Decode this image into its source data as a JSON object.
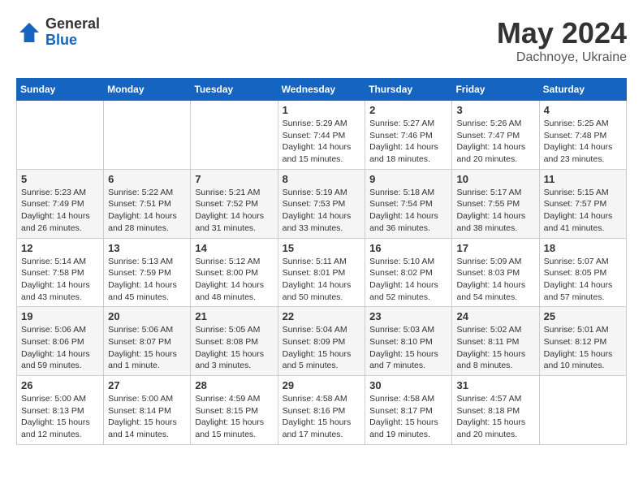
{
  "logo": {
    "general": "General",
    "blue": "Blue"
  },
  "title": {
    "month": "May 2024",
    "location": "Dachnoye, Ukraine"
  },
  "weekdays": [
    "Sunday",
    "Monday",
    "Tuesday",
    "Wednesday",
    "Thursday",
    "Friday",
    "Saturday"
  ],
  "rows": [
    [
      {
        "day": "",
        "sunrise": "",
        "sunset": "",
        "daylight": ""
      },
      {
        "day": "",
        "sunrise": "",
        "sunset": "",
        "daylight": ""
      },
      {
        "day": "",
        "sunrise": "",
        "sunset": "",
        "daylight": ""
      },
      {
        "day": "1",
        "sunrise": "Sunrise: 5:29 AM",
        "sunset": "Sunset: 7:44 PM",
        "daylight": "Daylight: 14 hours and 15 minutes."
      },
      {
        "day": "2",
        "sunrise": "Sunrise: 5:27 AM",
        "sunset": "Sunset: 7:46 PM",
        "daylight": "Daylight: 14 hours and 18 minutes."
      },
      {
        "day": "3",
        "sunrise": "Sunrise: 5:26 AM",
        "sunset": "Sunset: 7:47 PM",
        "daylight": "Daylight: 14 hours and 20 minutes."
      },
      {
        "day": "4",
        "sunrise": "Sunrise: 5:25 AM",
        "sunset": "Sunset: 7:48 PM",
        "daylight": "Daylight: 14 hours and 23 minutes."
      }
    ],
    [
      {
        "day": "5",
        "sunrise": "Sunrise: 5:23 AM",
        "sunset": "Sunset: 7:49 PM",
        "daylight": "Daylight: 14 hours and 26 minutes."
      },
      {
        "day": "6",
        "sunrise": "Sunrise: 5:22 AM",
        "sunset": "Sunset: 7:51 PM",
        "daylight": "Daylight: 14 hours and 28 minutes."
      },
      {
        "day": "7",
        "sunrise": "Sunrise: 5:21 AM",
        "sunset": "Sunset: 7:52 PM",
        "daylight": "Daylight: 14 hours and 31 minutes."
      },
      {
        "day": "8",
        "sunrise": "Sunrise: 5:19 AM",
        "sunset": "Sunset: 7:53 PM",
        "daylight": "Daylight: 14 hours and 33 minutes."
      },
      {
        "day": "9",
        "sunrise": "Sunrise: 5:18 AM",
        "sunset": "Sunset: 7:54 PM",
        "daylight": "Daylight: 14 hours and 36 minutes."
      },
      {
        "day": "10",
        "sunrise": "Sunrise: 5:17 AM",
        "sunset": "Sunset: 7:55 PM",
        "daylight": "Daylight: 14 hours and 38 minutes."
      },
      {
        "day": "11",
        "sunrise": "Sunrise: 5:15 AM",
        "sunset": "Sunset: 7:57 PM",
        "daylight": "Daylight: 14 hours and 41 minutes."
      }
    ],
    [
      {
        "day": "12",
        "sunrise": "Sunrise: 5:14 AM",
        "sunset": "Sunset: 7:58 PM",
        "daylight": "Daylight: 14 hours and 43 minutes."
      },
      {
        "day": "13",
        "sunrise": "Sunrise: 5:13 AM",
        "sunset": "Sunset: 7:59 PM",
        "daylight": "Daylight: 14 hours and 45 minutes."
      },
      {
        "day": "14",
        "sunrise": "Sunrise: 5:12 AM",
        "sunset": "Sunset: 8:00 PM",
        "daylight": "Daylight: 14 hours and 48 minutes."
      },
      {
        "day": "15",
        "sunrise": "Sunrise: 5:11 AM",
        "sunset": "Sunset: 8:01 PM",
        "daylight": "Daylight: 14 hours and 50 minutes."
      },
      {
        "day": "16",
        "sunrise": "Sunrise: 5:10 AM",
        "sunset": "Sunset: 8:02 PM",
        "daylight": "Daylight: 14 hours and 52 minutes."
      },
      {
        "day": "17",
        "sunrise": "Sunrise: 5:09 AM",
        "sunset": "Sunset: 8:03 PM",
        "daylight": "Daylight: 14 hours and 54 minutes."
      },
      {
        "day": "18",
        "sunrise": "Sunrise: 5:07 AM",
        "sunset": "Sunset: 8:05 PM",
        "daylight": "Daylight: 14 hours and 57 minutes."
      }
    ],
    [
      {
        "day": "19",
        "sunrise": "Sunrise: 5:06 AM",
        "sunset": "Sunset: 8:06 PM",
        "daylight": "Daylight: 14 hours and 59 minutes."
      },
      {
        "day": "20",
        "sunrise": "Sunrise: 5:06 AM",
        "sunset": "Sunset: 8:07 PM",
        "daylight": "Daylight: 15 hours and 1 minute."
      },
      {
        "day": "21",
        "sunrise": "Sunrise: 5:05 AM",
        "sunset": "Sunset: 8:08 PM",
        "daylight": "Daylight: 15 hours and 3 minutes."
      },
      {
        "day": "22",
        "sunrise": "Sunrise: 5:04 AM",
        "sunset": "Sunset: 8:09 PM",
        "daylight": "Daylight: 15 hours and 5 minutes."
      },
      {
        "day": "23",
        "sunrise": "Sunrise: 5:03 AM",
        "sunset": "Sunset: 8:10 PM",
        "daylight": "Daylight: 15 hours and 7 minutes."
      },
      {
        "day": "24",
        "sunrise": "Sunrise: 5:02 AM",
        "sunset": "Sunset: 8:11 PM",
        "daylight": "Daylight: 15 hours and 8 minutes."
      },
      {
        "day": "25",
        "sunrise": "Sunrise: 5:01 AM",
        "sunset": "Sunset: 8:12 PM",
        "daylight": "Daylight: 15 hours and 10 minutes."
      }
    ],
    [
      {
        "day": "26",
        "sunrise": "Sunrise: 5:00 AM",
        "sunset": "Sunset: 8:13 PM",
        "daylight": "Daylight: 15 hours and 12 minutes."
      },
      {
        "day": "27",
        "sunrise": "Sunrise: 5:00 AM",
        "sunset": "Sunset: 8:14 PM",
        "daylight": "Daylight: 15 hours and 14 minutes."
      },
      {
        "day": "28",
        "sunrise": "Sunrise: 4:59 AM",
        "sunset": "Sunset: 8:15 PM",
        "daylight": "Daylight: 15 hours and 15 minutes."
      },
      {
        "day": "29",
        "sunrise": "Sunrise: 4:58 AM",
        "sunset": "Sunset: 8:16 PM",
        "daylight": "Daylight: 15 hours and 17 minutes."
      },
      {
        "day": "30",
        "sunrise": "Sunrise: 4:58 AM",
        "sunset": "Sunset: 8:17 PM",
        "daylight": "Daylight: 15 hours and 19 minutes."
      },
      {
        "day": "31",
        "sunrise": "Sunrise: 4:57 AM",
        "sunset": "Sunset: 8:18 PM",
        "daylight": "Daylight: 15 hours and 20 minutes."
      },
      {
        "day": "",
        "sunrise": "",
        "sunset": "",
        "daylight": ""
      }
    ]
  ]
}
